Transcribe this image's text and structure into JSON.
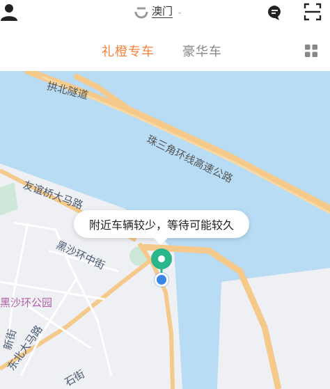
{
  "header": {
    "city": "澳门",
    "profile_icon": "person-icon",
    "city_logo_icon": "didi-logo-icon",
    "city_caret_icon": "chevron-down-icon",
    "message_icon": "message-bubble-icon",
    "scan_icon": "scan-icon"
  },
  "tabs": [
    {
      "label": "礼橙专车",
      "active": true
    },
    {
      "label": "豪华车",
      "active": false
    }
  ],
  "grid_icon": "grid-icon",
  "map": {
    "labels": {
      "tunnel": "拱北隧道",
      "highway": "珠三角环线高速公路",
      "youyi": "友谊桥大马路",
      "heisha": "黑沙环中街",
      "park": "黑沙环公园",
      "dongbei": "东北大马路",
      "xinjie": "新街",
      "shi": "石街"
    },
    "colors": {
      "water": "#b9dcf5",
      "land": "#eef0f4",
      "road": "#f5c98a",
      "accent": "#f5823c",
      "pin": "#2bb58a",
      "location": "#3a86e6"
    }
  },
  "callout": {
    "text": "附近车辆较少，等待可能较久"
  }
}
